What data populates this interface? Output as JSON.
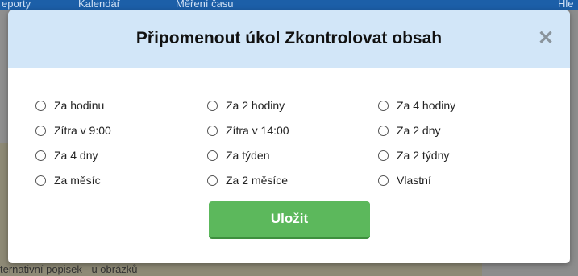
{
  "background": {
    "nav_items": [
      "eporty",
      "Kalendář",
      "Měření času",
      "Hle"
    ],
    "partial_text_bottom": "ternativní popisek - u obrázků"
  },
  "modal": {
    "title": "Připomenout úkol Zkontrolovat obsah",
    "close_label": "✕",
    "options": [
      [
        "Za hodinu",
        "Za 2 hodiny",
        "Za 4 hodiny"
      ],
      [
        "Zítra v 9:00",
        "Zítra v 14:00",
        "Za 2 dny"
      ],
      [
        "Za 4 dny",
        "Za týden",
        "Za 2 týdny"
      ],
      [
        "Za měsíc",
        "Za 2 měsíce",
        "Vlastní"
      ]
    ],
    "selected_option": null,
    "save_label": "Uložit"
  },
  "colors": {
    "header_bg": "#d2e6f8",
    "save_button": "#5cb85c",
    "topbar": "#1c5fa8"
  }
}
